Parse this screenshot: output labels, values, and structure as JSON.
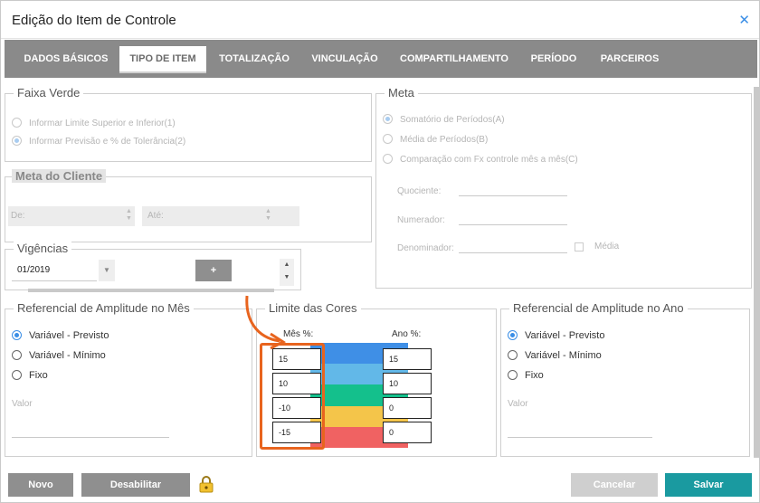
{
  "dialog": {
    "title": "Edição do Item de Controle",
    "close_icon": "close-icon"
  },
  "tabs": [
    {
      "label": "DADOS BÁSICOS"
    },
    {
      "label": "TIPO DE ITEM"
    },
    {
      "label": "TOTALIZAÇÃO"
    },
    {
      "label": "VINCULAÇÃO"
    },
    {
      "label": "COMPARTILHAMENTO"
    },
    {
      "label": "PERÍODO"
    },
    {
      "label": "PARCEIROS"
    }
  ],
  "faixa_verde": {
    "legend": "Faixa Verde",
    "options": [
      "Informar Limite Superior e Inferior(1)",
      "Informar Previsão e % de Tolerância(2)"
    ]
  },
  "meta": {
    "legend": "Meta",
    "options": [
      "Somatório de Períodos(A)",
      "Média de Períodos(B)",
      "Comparação com Fx controle mês a mês(C)"
    ],
    "quociente_label": "Quociente:",
    "numerador_label": "Numerador:",
    "denominador_label": "Denominador:",
    "media_label": "Média"
  },
  "meta_cliente": {
    "legend": "Meta do Cliente",
    "de_label": "De:",
    "ate_label": "Até:"
  },
  "vigencias": {
    "legend": "Vigências",
    "value": "01/2019",
    "add_label": "+"
  },
  "ref_mes": {
    "legend": "Referencial de Amplitude no Mês",
    "options": [
      "Variável - Previsto",
      "Variável - Mínimo",
      "Fixo"
    ],
    "valor_label": "Valor"
  },
  "limite_cores": {
    "legend": "Limite das Cores",
    "mes_label": "Mês %:",
    "ano_label": "Ano %:",
    "mes_values": [
      "15",
      "10",
      "-10",
      "-15"
    ],
    "ano_values": [
      "15",
      "10",
      "0",
      "0"
    ],
    "colors": [
      "#3f8fe6",
      "#62b8e8",
      "#14c08c",
      "#f4c54a",
      "#f06262"
    ]
  },
  "ref_ano": {
    "legend": "Referencial de Amplitude no Ano",
    "options": [
      "Variável - Previsto",
      "Variável - Mínimo",
      "Fixo"
    ],
    "valor_label": "Valor"
  },
  "footer": {
    "novo": "Novo",
    "desabilitar": "Desabilitar",
    "lock_icon": "lock-icon",
    "cancelar": "Cancelar",
    "salvar": "Salvar"
  },
  "colors": {
    "accent": "#1a9aa0",
    "tab_bar": "#8a8a8a",
    "annotation": "#e8641e"
  }
}
